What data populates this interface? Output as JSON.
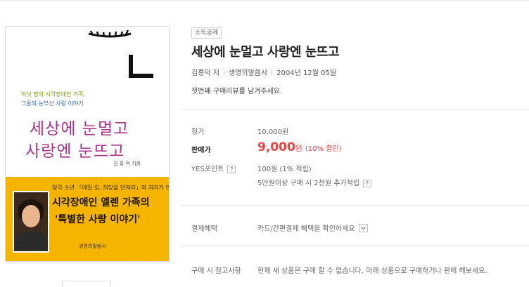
{
  "cover": {
    "tagline1": "여섯 명의 시각장애인 가족,",
    "tagline2": "그들의 눈부신 사랑 이야기",
    "title_line1": "세상에 눈멀고",
    "title_line2": "사랑엔 눈뜨고",
    "author": "김 홍 덕 지음",
    "band_small": "청각 소년 「에밀 킹, 희망을 던져라」의 저자가 만난",
    "band_big1": "시각장애인 엘렌 가족의",
    "band_big2": "'특별한 사랑 이야기'",
    "publisher": "생명의말씀사"
  },
  "product": {
    "badge": "소득공제",
    "title": "세상에 눈멀고 사랑엔 눈뜨고",
    "author": "김홍덕 저",
    "publisher": "생명의말씀사",
    "date": "2004년 12월 05일",
    "review_prompt": "첫번째 구매리뷰를 남겨주세요."
  },
  "pricing": {
    "list_price_label": "정가",
    "list_price": "10,000원",
    "sale_label": "판매가",
    "sale_amount": "9,000",
    "sale_unit": "원",
    "discount": "(10% 할인)",
    "points_label": "YES포인트",
    "points_help": "?",
    "points_value": "100원 (1% 적립)",
    "extra_points": "5만원이상 구매 시 2천원 추가적립",
    "extra_help": "?"
  },
  "payment": {
    "label": "결제혜택",
    "value": "카드/간편결제 혜택을 확인하세요"
  },
  "notice": {
    "label": "구매 시 참고사항",
    "value": "현재 새 상품은 구매 할 수 없습니다. 아래 상품으로 구매하거나 판매 해보세요."
  },
  "colors": {
    "sale_price": "#f04040",
    "cover_title": "#a8338a",
    "cover_band": "#f5b400"
  }
}
